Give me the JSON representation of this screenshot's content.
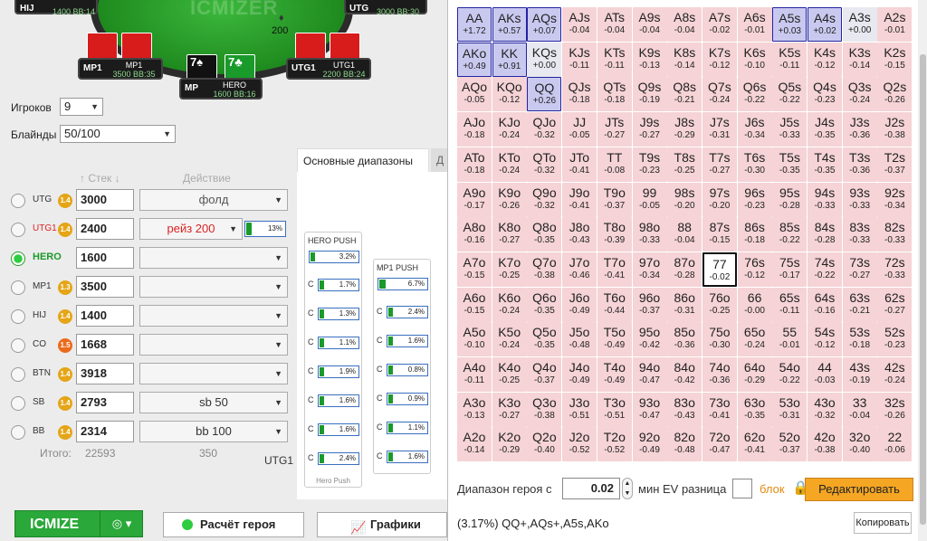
{
  "table": {
    "logo": "ICMIZER",
    "pot": "200",
    "pot_chip": "♦",
    "seats": [
      {
        "pos": "HIJ",
        "stack": "1400",
        "bb": "BB:14"
      },
      {
        "pos": "UTG",
        "stack": "3000",
        "bb": "BB:30"
      },
      {
        "pos": "MP1",
        "name": "MP1",
        "stack": "3500",
        "bb": "BB:35"
      },
      {
        "pos": "MP",
        "name": "HERO",
        "stack": "1600",
        "bb": "BB:16"
      },
      {
        "pos": "UTG1",
        "name": "UTG1",
        "stack": "2200",
        "bb": "BB:24"
      }
    ],
    "hero_cards": [
      "7♠",
      "7♣"
    ]
  },
  "form": {
    "players_label": "Игроков",
    "players_value": "9",
    "blinds_label": "Блайнды",
    "blinds_value": "50/100",
    "stack_header": "Стек",
    "action_header": "Действие"
  },
  "players": [
    {
      "pos": "UTG",
      "icm": "1.4",
      "stack": "3000",
      "action": "фолд"
    },
    {
      "pos": "UTG1",
      "icm": "1.4",
      "stack": "2400",
      "action": "рейз 200",
      "pct": "13%"
    },
    {
      "pos": "HERO",
      "icm": "",
      "stack": "1600",
      "action": ""
    },
    {
      "pos": "MP1",
      "icm": "1.3",
      "stack": "3500",
      "action": ""
    },
    {
      "pos": "HIJ",
      "icm": "1.4",
      "stack": "1400",
      "action": ""
    },
    {
      "pos": "CO",
      "icm": "1.5",
      "stack": "1668",
      "action": ""
    },
    {
      "pos": "BTN",
      "icm": "1.4",
      "stack": "3918",
      "action": ""
    },
    {
      "pos": "SB",
      "icm": "1.4",
      "stack": "2793",
      "action": "sb 50"
    },
    {
      "pos": "BB",
      "icm": "1.4",
      "stack": "2314",
      "action": "bb 100"
    }
  ],
  "totals": {
    "label": "Итого:",
    "value": "22593",
    "sb_value": "350",
    "utg1_label": "UTG1"
  },
  "ranges": {
    "tab_main": "Основные диапазоны",
    "tab_other": "Д",
    "hero_push_title": "HERO PUSH",
    "mp1_push_title": "MP1 PUSH",
    "hero_push_footer": "Hero Push",
    "c_label": "C",
    "hero_push": [
      "3.2%",
      "1.7%",
      "1.3%",
      "1.1%",
      "1.9%",
      "1.6%",
      "1.6%",
      "2.4%"
    ],
    "mp1_push": [
      "6.7%",
      "2.4%",
      "1.6%",
      "0.8%",
      "0.9%",
      "1.1%",
      "1.6%"
    ]
  },
  "buttons": {
    "icmize": "ICMIZE",
    "hero_calc": "Расчёт героя",
    "graphs": "Графики",
    "edit": "Редактировать",
    "copy": "Копировать"
  },
  "icons": {
    "dropdown": "◎ ▾",
    "graph": "📈",
    "lock": "🔒"
  },
  "range_controls": {
    "label": "Диапазон героя с",
    "value": "0.02",
    "min_ev_label": "мин EV разница",
    "block_label": "блок"
  },
  "combo_text": "(3.17%) QQ+,AQs+,A5s,AKo",
  "grid": [
    [
      [
        "AA",
        "+1.72"
      ],
      [
        "AKs",
        "+0.57"
      ],
      [
        "AQs",
        "+0.07"
      ],
      [
        "AJs",
        "-0.04"
      ],
      [
        "ATs",
        "-0.04"
      ],
      [
        "A9s",
        "-0.04"
      ],
      [
        "A8s",
        "-0.04"
      ],
      [
        "A7s",
        "-0.02"
      ],
      [
        "A6s",
        "-0.01"
      ],
      [
        "A5s",
        "+0.03"
      ],
      [
        "A4s",
        "+0.02"
      ],
      [
        "A3s",
        "+0.00"
      ],
      [
        "A2s",
        "-0.01"
      ]
    ],
    [
      [
        "AKo",
        "+0.49"
      ],
      [
        "KK",
        "+0.91"
      ],
      [
        "KQs",
        "+0.00"
      ],
      [
        "KJs",
        "-0.11"
      ],
      [
        "KTs",
        "-0.11"
      ],
      [
        "K9s",
        "-0.13"
      ],
      [
        "K8s",
        "-0.14"
      ],
      [
        "K7s",
        "-0.12"
      ],
      [
        "K6s",
        "-0.10"
      ],
      [
        "K5s",
        "-0.11"
      ],
      [
        "K4s",
        "-0.12"
      ],
      [
        "K3s",
        "-0.14"
      ],
      [
        "K2s",
        "-0.15"
      ]
    ],
    [
      [
        "AQo",
        "-0.05"
      ],
      [
        "KQo",
        "-0.12"
      ],
      [
        "QQ",
        "+0.26"
      ],
      [
        "QJs",
        "-0.18"
      ],
      [
        "QTs",
        "-0.18"
      ],
      [
        "Q9s",
        "-0.19"
      ],
      [
        "Q8s",
        "-0.21"
      ],
      [
        "Q7s",
        "-0.24"
      ],
      [
        "Q6s",
        "-0.22"
      ],
      [
        "Q5s",
        "-0.22"
      ],
      [
        "Q4s",
        "-0.23"
      ],
      [
        "Q3s",
        "-0.24"
      ],
      [
        "Q2s",
        "-0.26"
      ]
    ],
    [
      [
        "AJo",
        "-0.18"
      ],
      [
        "KJo",
        "-0.24"
      ],
      [
        "QJo",
        "-0.32"
      ],
      [
        "JJ",
        "-0.05"
      ],
      [
        "JTs",
        "-0.27"
      ],
      [
        "J9s",
        "-0.27"
      ],
      [
        "J8s",
        "-0.29"
      ],
      [
        "J7s",
        "-0.31"
      ],
      [
        "J6s",
        "-0.34"
      ],
      [
        "J5s",
        "-0.33"
      ],
      [
        "J4s",
        "-0.35"
      ],
      [
        "J3s",
        "-0.36"
      ],
      [
        "J2s",
        "-0.38"
      ]
    ],
    [
      [
        "ATo",
        "-0.18"
      ],
      [
        "KTo",
        "-0.24"
      ],
      [
        "QTo",
        "-0.32"
      ],
      [
        "JTo",
        "-0.41"
      ],
      [
        "TT",
        "-0.08"
      ],
      [
        "T9s",
        "-0.23"
      ],
      [
        "T8s",
        "-0.25"
      ],
      [
        "T7s",
        "-0.27"
      ],
      [
        "T6s",
        "-0.30"
      ],
      [
        "T5s",
        "-0.35"
      ],
      [
        "T4s",
        "-0.35"
      ],
      [
        "T3s",
        "-0.36"
      ],
      [
        "T2s",
        "-0.37"
      ]
    ],
    [
      [
        "A9o",
        "-0.17"
      ],
      [
        "K9o",
        "-0.26"
      ],
      [
        "Q9o",
        "-0.32"
      ],
      [
        "J9o",
        "-0.41"
      ],
      [
        "T9o",
        "-0.37"
      ],
      [
        "99",
        "-0.05"
      ],
      [
        "98s",
        "-0.20"
      ],
      [
        "97s",
        "-0.20"
      ],
      [
        "96s",
        "-0.23"
      ],
      [
        "95s",
        "-0.28"
      ],
      [
        "94s",
        "-0.33"
      ],
      [
        "93s",
        "-0.33"
      ],
      [
        "92s",
        "-0.34"
      ]
    ],
    [
      [
        "A8o",
        "-0.16"
      ],
      [
        "K8o",
        "-0.27"
      ],
      [
        "Q8o",
        "-0.35"
      ],
      [
        "J8o",
        "-0.43"
      ],
      [
        "T8o",
        "-0.39"
      ],
      [
        "98o",
        "-0.33"
      ],
      [
        "88",
        "-0.04"
      ],
      [
        "87s",
        "-0.15"
      ],
      [
        "86s",
        "-0.18"
      ],
      [
        "85s",
        "-0.22"
      ],
      [
        "84s",
        "-0.28"
      ],
      [
        "83s",
        "-0.33"
      ],
      [
        "82s",
        "-0.33"
      ]
    ],
    [
      [
        "A7o",
        "-0.15"
      ],
      [
        "K7o",
        "-0.25"
      ],
      [
        "Q7o",
        "-0.38"
      ],
      [
        "J7o",
        "-0.46"
      ],
      [
        "T7o",
        "-0.41"
      ],
      [
        "97o",
        "-0.34"
      ],
      [
        "87o",
        "-0.28"
      ],
      [
        "77",
        "-0.02"
      ],
      [
        "76s",
        "-0.12"
      ],
      [
        "75s",
        "-0.17"
      ],
      [
        "74s",
        "-0.22"
      ],
      [
        "73s",
        "-0.27"
      ],
      [
        "72s",
        "-0.33"
      ]
    ],
    [
      [
        "A6o",
        "-0.15"
      ],
      [
        "K6o",
        "-0.24"
      ],
      [
        "Q6o",
        "-0.35"
      ],
      [
        "J6o",
        "-0.49"
      ],
      [
        "T6o",
        "-0.44"
      ],
      [
        "96o",
        "-0.37"
      ],
      [
        "86o",
        "-0.31"
      ],
      [
        "76o",
        "-0.25"
      ],
      [
        "66",
        "-0.00"
      ],
      [
        "65s",
        "-0.11"
      ],
      [
        "64s",
        "-0.16"
      ],
      [
        "63s",
        "-0.21"
      ],
      [
        "62s",
        "-0.27"
      ]
    ],
    [
      [
        "A5o",
        "-0.10"
      ],
      [
        "K5o",
        "-0.24"
      ],
      [
        "Q5o",
        "-0.35"
      ],
      [
        "J5o",
        "-0.48"
      ],
      [
        "T5o",
        "-0.49"
      ],
      [
        "95o",
        "-0.42"
      ],
      [
        "85o",
        "-0.36"
      ],
      [
        "75o",
        "-0.30"
      ],
      [
        "65o",
        "-0.24"
      ],
      [
        "55",
        "-0.01"
      ],
      [
        "54s",
        "-0.12"
      ],
      [
        "53s",
        "-0.18"
      ],
      [
        "52s",
        "-0.23"
      ]
    ],
    [
      [
        "A4o",
        "-0.11"
      ],
      [
        "K4o",
        "-0.25"
      ],
      [
        "Q4o",
        "-0.37"
      ],
      [
        "J4o",
        "-0.49"
      ],
      [
        "T4o",
        "-0.49"
      ],
      [
        "94o",
        "-0.47"
      ],
      [
        "84o",
        "-0.42"
      ],
      [
        "74o",
        "-0.36"
      ],
      [
        "64o",
        "-0.29"
      ],
      [
        "54o",
        "-0.22"
      ],
      [
        "44",
        "-0.03"
      ],
      [
        "43s",
        "-0.19"
      ],
      [
        "42s",
        "-0.24"
      ]
    ],
    [
      [
        "A3o",
        "-0.13"
      ],
      [
        "K3o",
        "-0.27"
      ],
      [
        "Q3o",
        "-0.38"
      ],
      [
        "J3o",
        "-0.51"
      ],
      [
        "T3o",
        "-0.51"
      ],
      [
        "93o",
        "-0.47"
      ],
      [
        "83o",
        "-0.43"
      ],
      [
        "73o",
        "-0.41"
      ],
      [
        "63o",
        "-0.35"
      ],
      [
        "53o",
        "-0.31"
      ],
      [
        "43o",
        "-0.32"
      ],
      [
        "33",
        "-0.04"
      ],
      [
        "32s",
        "-0.26"
      ]
    ],
    [
      [
        "A2o",
        "-0.14"
      ],
      [
        "K2o",
        "-0.29"
      ],
      [
        "Q2o",
        "-0.40"
      ],
      [
        "J2o",
        "-0.52"
      ],
      [
        "T2o",
        "-0.52"
      ],
      [
        "92o",
        "-0.49"
      ],
      [
        "82o",
        "-0.48"
      ],
      [
        "72o",
        "-0.47"
      ],
      [
        "62o",
        "-0.41"
      ],
      [
        "52o",
        "-0.37"
      ],
      [
        "42o",
        "-0.38"
      ],
      [
        "32o",
        "-0.40"
      ],
      [
        "22",
        "-0.06"
      ]
    ]
  ],
  "highlight_hand": "77",
  "colors": {
    "positive": "#c9c9f0",
    "negative": "#f5d3d6",
    "accent_green": "#2aa839",
    "accent_orange": "#f5a623"
  }
}
